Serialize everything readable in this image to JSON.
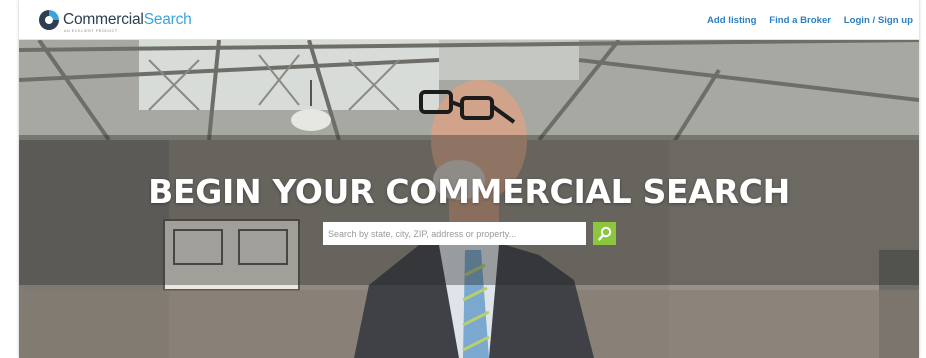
{
  "header": {
    "logo": {
      "word1": "Commercial",
      "word2": "Search",
      "tagline": "AN ECKLIENT PRODUCT"
    },
    "nav": [
      {
        "label": "Add listing"
      },
      {
        "label": "Find a Broker"
      },
      {
        "label": "Login / Sign up"
      }
    ]
  },
  "hero": {
    "title": "BEGIN YOUR COMMERCIAL SEARCH",
    "search": {
      "placeholder": "Search by state, city, ZIP, address or property...",
      "value": ""
    },
    "search_icon": "search-icon"
  },
  "colors": {
    "logo_dark": "#2c3e50",
    "logo_accent": "#39a5dc",
    "nav_link": "#2d7fc1",
    "search_button": "#8cc63f"
  }
}
